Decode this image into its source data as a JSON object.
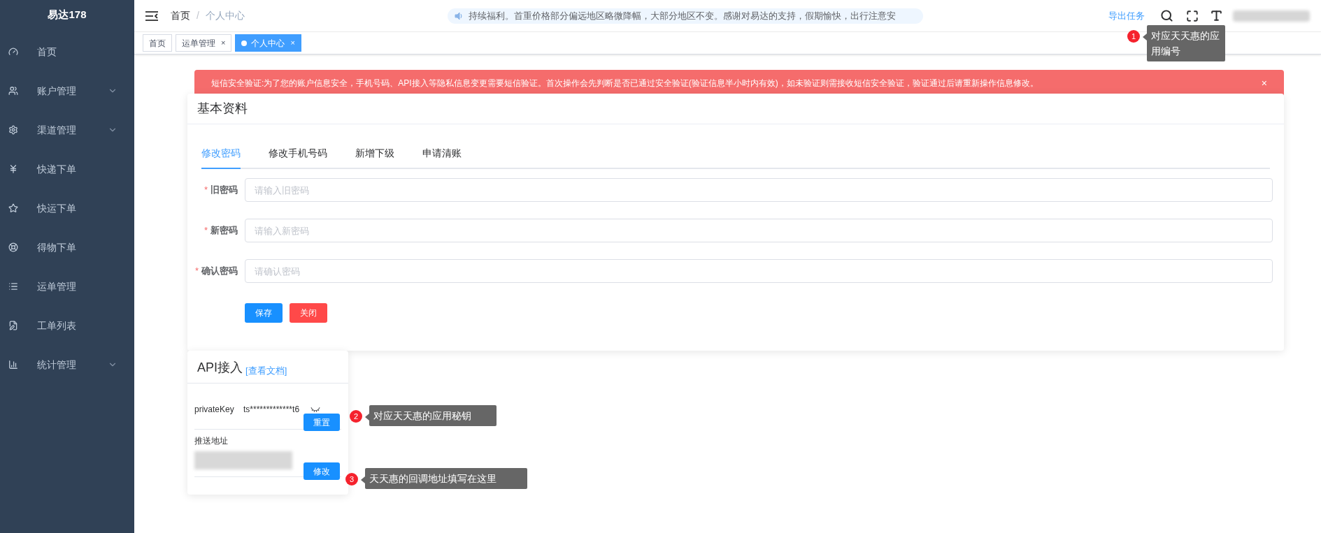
{
  "sidebar": {
    "logo": "易达178",
    "items": [
      {
        "label": "首页",
        "kind": "dashboard",
        "has_submenu": false
      },
      {
        "label": "账户管理",
        "kind": "users",
        "has_submenu": true
      },
      {
        "label": "渠道管理",
        "kind": "gear",
        "has_submenu": true
      },
      {
        "label": "快递下单",
        "kind": "yen",
        "has_submenu": false
      },
      {
        "label": "快运下单",
        "kind": "star",
        "has_submenu": false
      },
      {
        "label": "得物下单",
        "kind": "lifebuoy",
        "has_submenu": false
      },
      {
        "label": "运单管理",
        "kind": "list",
        "has_submenu": false
      },
      {
        "label": "工单列表",
        "kind": "document",
        "has_submenu": false
      },
      {
        "label": "统计管理",
        "kind": "chart",
        "has_submenu": true
      }
    ]
  },
  "topbar": {
    "breadcrumb": [
      "首页",
      "个人中心"
    ],
    "separator": "/",
    "notice": "持续福利。首重价格部分偏远地区略微降幅，大部分地区不变。感谢对易达的支持，假期愉快，出行注意安",
    "export_link": "导出任务"
  },
  "tabs": [
    {
      "label": "首页",
      "selected": false
    },
    {
      "label": "运单管理",
      "selected": false,
      "close_mark": "×"
    },
    {
      "label": "个人中心",
      "selected": true,
      "close_mark": "×"
    }
  ],
  "alert": {
    "message": "短信安全验证:为了您的账户信息安全，手机号码、API接入等隐私信息变更需要短信验证。首次操作会先判断是否已通过安全验证(验证信息半小时内有效)，如未验证则需接收短信安全验证，验证通过后请重新操作信息修改。",
    "close": "×"
  },
  "profile_card": {
    "title": "基本资料",
    "tabs": [
      {
        "label": "修改密码",
        "selected": true
      },
      {
        "label": "修改手机号码",
        "selected": false
      },
      {
        "label": "新增下级",
        "selected": false
      },
      {
        "label": "申请清账",
        "selected": false
      }
    ],
    "fields": [
      {
        "label": "旧密码",
        "required_mark": "*",
        "placeholder": "请输入旧密码"
      },
      {
        "label": "新密码",
        "required_mark": "*",
        "placeholder": "请输入新密码"
      },
      {
        "label": "确认密码",
        "required_mark": "*",
        "placeholder": "请确认密码"
      }
    ],
    "buttons": [
      {
        "label": "保存",
        "kind": "primary"
      },
      {
        "label": "关闭",
        "kind": "danger"
      }
    ]
  },
  "api_card": {
    "title": "API接入",
    "doc_link": "[查看文档]",
    "rows": [
      {
        "kind": "key",
        "label": "privateKey",
        "value": "ts*************t6",
        "button": "重置"
      },
      {
        "kind": "url",
        "label": "推送地址",
        "button": "修改"
      }
    ]
  },
  "annotations": [
    {
      "number": "1",
      "text": "对应天天惠的应用编号"
    },
    {
      "number": "2",
      "text": "对应天天惠的应用秘钥"
    },
    {
      "number": "3",
      "text": "天天惠的回调地址填写在这里"
    }
  ]
}
